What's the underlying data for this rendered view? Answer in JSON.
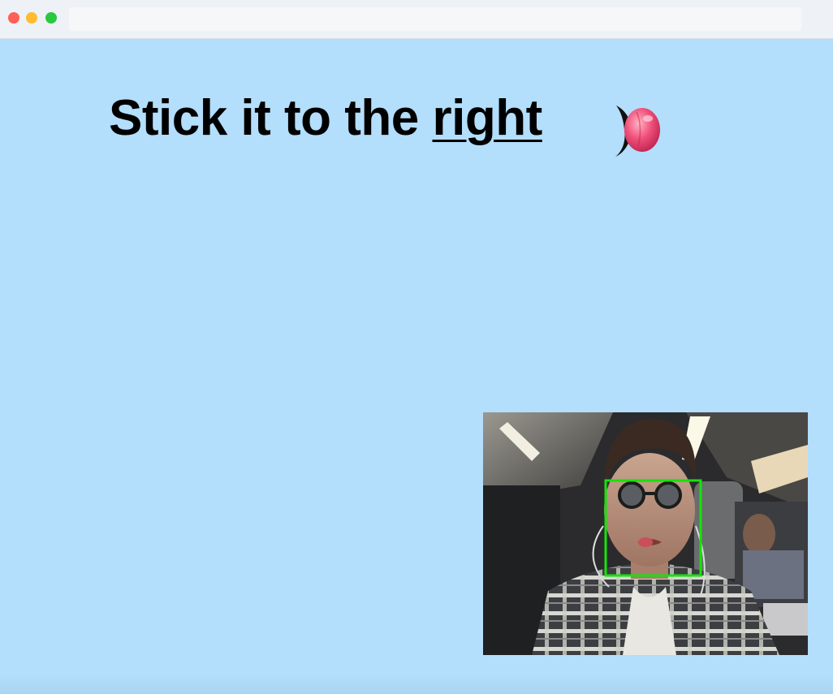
{
  "window": {
    "controls": [
      "close",
      "minimize",
      "zoom"
    ],
    "address_bar": ""
  },
  "main": {
    "instruction_prefix": "Stick it to the ",
    "instruction_direction": "right",
    "indicator_icon": "tongue-icon"
  },
  "camera": {
    "subject": "webcam feed",
    "face_box_color": "#18e10a"
  },
  "colors": {
    "background": "#b3defc",
    "text": "#000000"
  }
}
